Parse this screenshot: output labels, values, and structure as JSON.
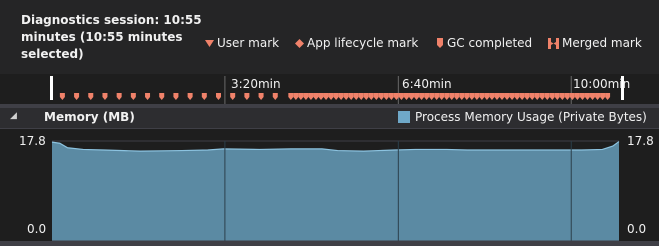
{
  "session": {
    "title": "Diagnostics session: 10:55 minutes (10:55 minutes selected)"
  },
  "legend": {
    "user_mark": "User mark",
    "app_lifecycle_mark": "App lifecycle mark",
    "gc_completed": "GC completed",
    "merged_mark": "Merged mark"
  },
  "timeline": {
    "tick_labels": [
      "3:20min",
      "6:40min",
      "10:00min"
    ],
    "marks": {
      "groups": [
        {
          "start_min": 0.2,
          "end_min": 4.3,
          "count": 16
        },
        {
          "start_min": 4.6,
          "end_min": 10.7,
          "count": 64
        }
      ]
    }
  },
  "memory": {
    "title": "Memory (MB)",
    "series_label": "Process Memory Usage (Private Bytes)",
    "y_max_label": "17.8",
    "y_min_label": "0.0"
  },
  "colors": {
    "mark": "#f0826a",
    "series_fill": "#5b8aa3",
    "series_line": "#8cc3e0",
    "legend_swatch": "#6fa8c8"
  },
  "chart_data": {
    "type": "area",
    "title": "Memory (MB)",
    "xlabel": "",
    "ylabel": "",
    "ylim": [
      0,
      17.8
    ],
    "xlim": [
      0,
      10.92
    ],
    "grid": false,
    "legend_position": "top-right",
    "series": [
      {
        "name": "Process Memory Usage (Private Bytes)",
        "x": [
          0,
          0.15,
          0.3,
          0.6,
          1.0,
          1.7,
          2.5,
          3.0,
          3.3,
          4.0,
          4.6,
          5.2,
          5.5,
          6.0,
          6.6,
          7.0,
          7.6,
          8.0,
          8.6,
          9.2,
          9.8,
          10.2,
          10.6,
          10.8,
          10.92
        ],
        "values": [
          17.6,
          17.4,
          16.6,
          16.3,
          16.2,
          16.0,
          16.1,
          16.2,
          16.4,
          16.3,
          16.4,
          16.4,
          16.1,
          16.0,
          16.2,
          16.3,
          16.3,
          16.2,
          16.2,
          16.2,
          16.2,
          16.2,
          16.3,
          16.9,
          17.7
        ]
      }
    ]
  }
}
